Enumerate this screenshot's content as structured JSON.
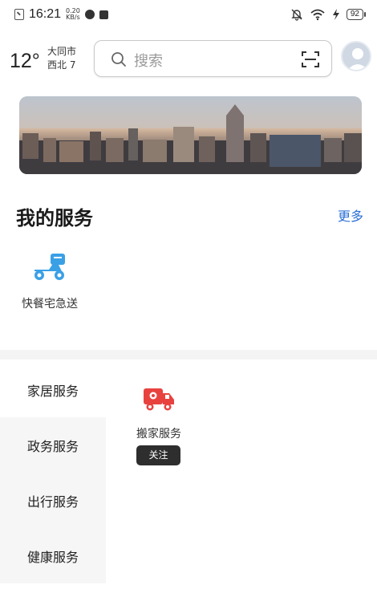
{
  "status_bar": {
    "time": "16:21",
    "speed_value": "0.20",
    "speed_unit": "KB/s",
    "battery": "92"
  },
  "weather": {
    "temperature": "12°",
    "city": "大同市",
    "wind": "西北 7"
  },
  "search": {
    "placeholder": "搜索"
  },
  "my_services": {
    "title": "我的服务",
    "more_label": "更多",
    "items": [
      {
        "label": "快餐宅急送",
        "icon": "delivery-scooter-icon"
      }
    ]
  },
  "categories": {
    "items": [
      {
        "label": "家居服务",
        "active": true
      },
      {
        "label": "政务服务",
        "active": false
      },
      {
        "label": "出行服务",
        "active": false
      },
      {
        "label": "健康服务",
        "active": false
      }
    ],
    "content": [
      {
        "label": "搬家服务",
        "icon": "moving-truck-icon",
        "button_label": "关注"
      }
    ]
  },
  "colors": {
    "accent_blue": "#2a6fd6",
    "icon_blue": "#3aa0e6",
    "icon_red": "#e8423f",
    "button_dark": "#2e2e2e"
  }
}
